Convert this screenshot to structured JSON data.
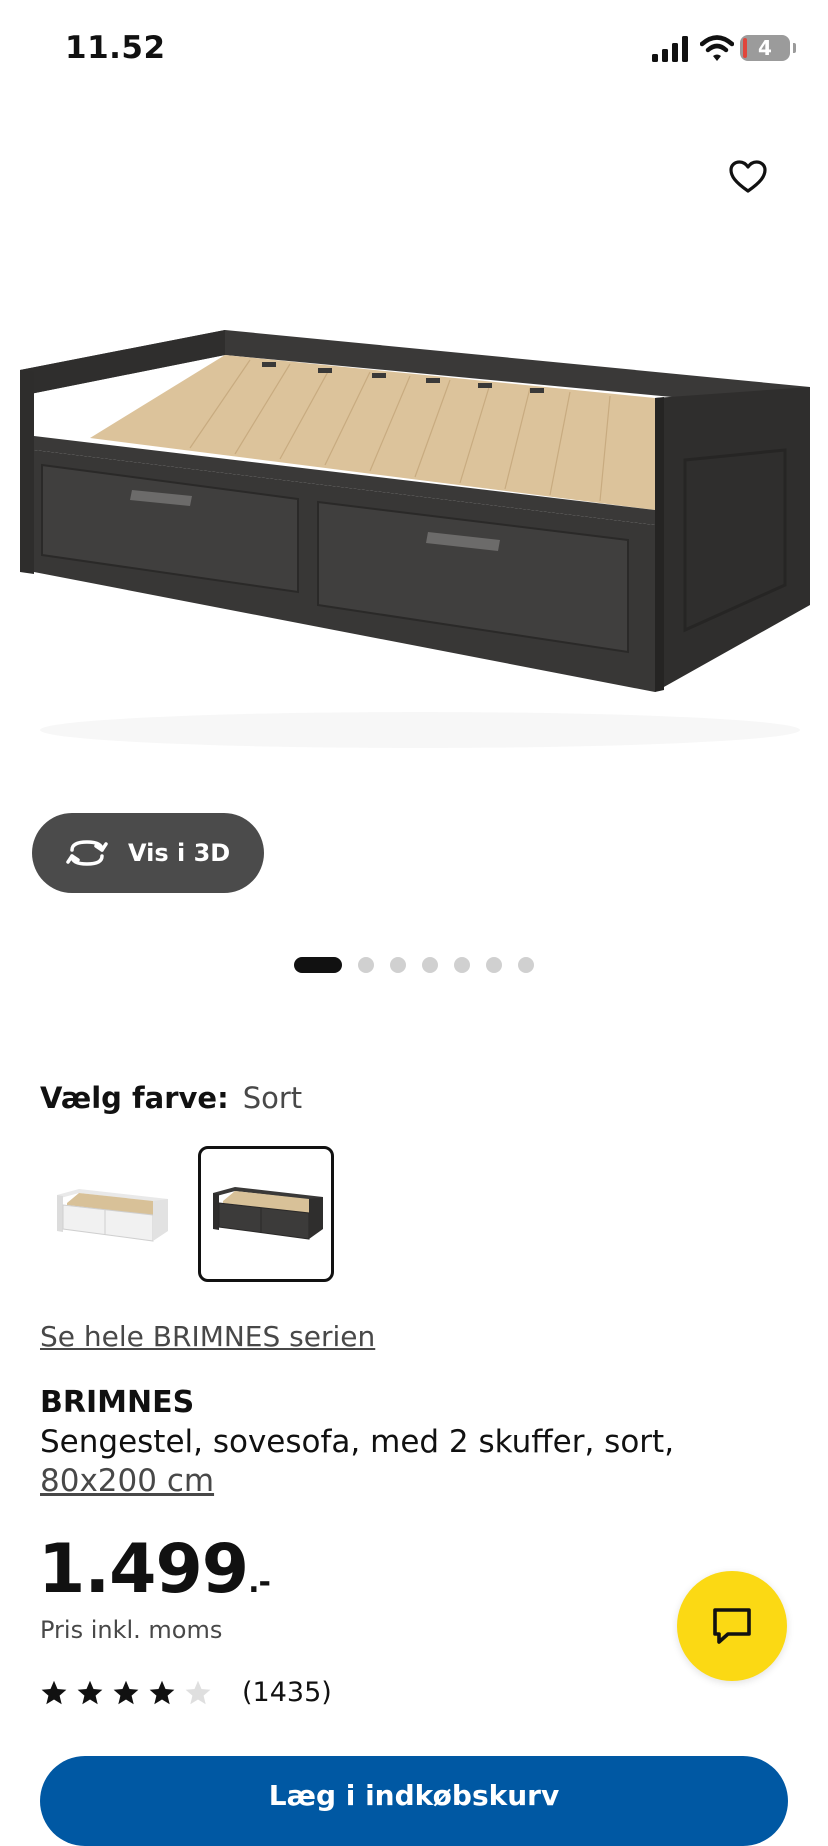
{
  "status_bar": {
    "time": "11.52",
    "battery_level": "4"
  },
  "gallery": {
    "view_3d_label": "Vis i 3D",
    "image_count": 7,
    "active_index": 0
  },
  "color_picker": {
    "label": "Vælg farve:",
    "selected": "Sort",
    "options": [
      "white",
      "black"
    ]
  },
  "series_link": "Se hele BRIMNES serien",
  "product": {
    "name": "BRIMNES",
    "description": "Sengestel, sovesofa, med 2 skuffer, sort,",
    "size": "80x200 cm",
    "price": "1.499",
    "price_suffix": ".-",
    "vat_note": "Pris inkl. moms",
    "rating": 4,
    "rating_max": 5,
    "review_count": "(1435)"
  },
  "actions": {
    "add_to_cart": "Læg i indkøbskurv"
  },
  "colors": {
    "accent_yellow": "#fbd914",
    "primary_blue": "#0058a3",
    "frame_dark": "#3b3a39",
    "wood": "#ddc39b"
  },
  "icons": [
    "signal-icon",
    "wifi-icon",
    "battery-icon",
    "heart-icon",
    "rotate-3d-icon",
    "chat-icon",
    "star-icon"
  ]
}
